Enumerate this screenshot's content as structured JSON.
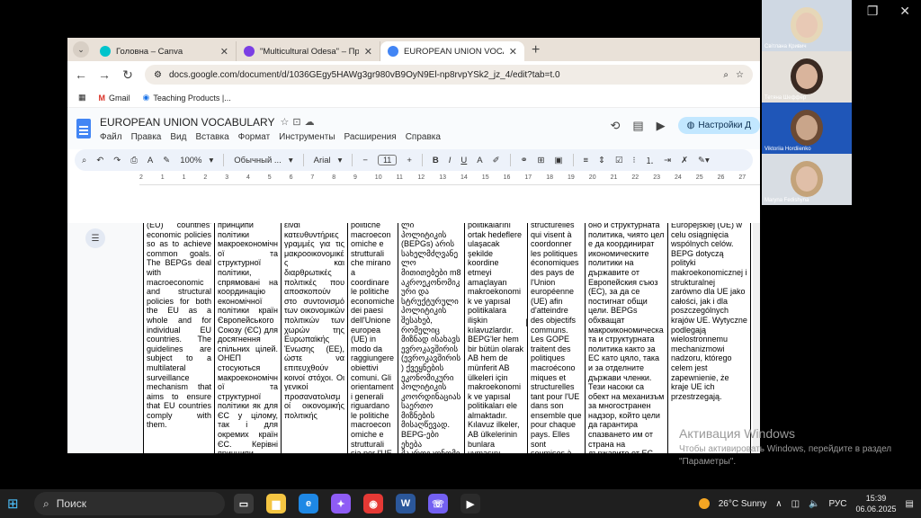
{
  "browser": {
    "tabs": [
      {
        "title": "Головна – Canva",
        "color": "#00c4cc",
        "active": false
      },
      {
        "title": "\"Multicultural Odesa\" – Презен",
        "color": "#7b3fe4",
        "active": false
      },
      {
        "title": "EUROPEAN UNION VOCABULA",
        "color": "#4285f4",
        "active": true
      }
    ],
    "url": "docs.google.com/document/d/1036GEgy5HAWg3gr980vB9OyN9El-np8rvpYSk2_jz_4/edit?tab=t.0",
    "bookmarks": [
      {
        "label": "Gmail"
      },
      {
        "label": "Teaching Products |..."
      }
    ]
  },
  "doc": {
    "title": "EUROPEAN UNION VOCABULARY",
    "menu": [
      "Файл",
      "Правка",
      "Вид",
      "Вставка",
      "Формат",
      "Инструменты",
      "Расширения",
      "Справка"
    ],
    "share_label": "Настройки Д",
    "toolbar": {
      "zoom": "100%",
      "style": "Обычный ...",
      "font": "Arial",
      "size": "11"
    },
    "ruler": [
      "2",
      "1",
      "1",
      "2",
      "3",
      "4",
      "5",
      "6",
      "7",
      "8",
      "9",
      "10",
      "11",
      "12",
      "13",
      "14",
      "15",
      "16",
      "17",
      "18",
      "19",
      "20",
      "21",
      "22",
      "23",
      "24",
      "25",
      "26",
      "27"
    ],
    "columns": [
      {
        "text": "(EU) countries' economic policies so as to achieve common goals. The BEPGs deal with macroeconomic and structural policies for both the EU as a whole and for individual EU countries. The guidelines are subject to a multilateral surveillance mechanism that aims to ensure that EU countries comply with them.",
        "width": 80,
        "justify": true
      },
      {
        "text": "принципи політики макроекономічної та структурної політики, спрямовані на координацію економічної політики країн Європейського Союзу (ЄС) для досягнення спільних цілей. ОНЕП стосуються макроекономічної та структурної політики як для ЄС у цілому, так і для окремих країн ЄС. Керівні принципи підлягають багатосторонньому",
        "width": 74,
        "justify": true
      },
      {
        "text": "είναι κατευθυντήριες γραμμές για τις μακροοικονομικές και διαρθρωτικές πολιτικές που αποσκοπούν στο συντονισμό των οικονομικών πολιτικών των χωρών της Ευρωπαϊκής Ένωσης (ΕΕ), ώστε να επιτευχθούν κοινοί στόχοι. Οι γενικοί προσανατολισμοί οικονομικής πολιτικής",
        "width": 74,
        "justify": true
      },
      {
        "text": "politiche macroeconomiche e strutturali che mirano a coordinare le politiche economiche dei paesi dell'Unione europea (UE) in modo da raggiungere obiettivi comuni. Gli orientamenti generali riguardano le politiche macroeconomiche e strutturali sia per l'UE nel suo complesso sia per i singoli paesi dell'UE. Gli orientamenti sono soggetti a",
        "width": 56,
        "justify": false
      },
      {
        "text": "ლი პოლიტიკის (BEPGs) არის სახელმძღვანელო მითითებები m8 აკროეკონომიკური და სტრუქტურული პოლიტიკის შესახებ, რომელიც მიზნად ისახავს ევროკავშირის (ევროკავშირის) ქვეყნების ეკონომიკური პოლიტიკის კოორდინაციას საერთო მიზნების მისაღწევად. BEPG-ები ეხება მაკროეკონომიკურ და სტრუქტურულ",
        "width": 74,
        "justify": false
      },
      {
        "text": "politikalarını ortak hedeflere ulaşacak şekilde koordine etmeyi amaçlayan makroekonomik ve yapısal politikalara ilişkin kılavuzlardır. BEPG'ler hem bir bütün olarak AB hem de münferit AB ülkeleri için makroekonomik ve yapısal politikaları ele almaktadır. Kılavuz ilkeler, AB ülkelerinin bunlara uymasını sağlamayı amaçlayan çok taraflı bir gözetim mekanizmasına",
        "width": 70,
        "justify": false
      },
      {
        "text": "structurelles qui visent à coordonner les politiques économiques des pays de l'Union européenne (UE) afin d'atteindre des objectifs communs. Les GOPE traitent des politiques macroéconomiques et structurelles tant pour l'UE dans son ensemble que pour chaque pays. Elles sont soumises à un mécanisme de surveillance",
        "width": 64,
        "justify": false
      },
      {
        "text": "оно и структурната политика, чиято цел е да координират икономическите политики на държавите от Европейския съюз (ЕС), за да се постигнат общи цели. BEPGs обхващат макроикономическата и структурната политика както за ЕС като цяло, така и за отделните държави членки. Тези насоки са обект на механизъм за многостранен надзор, който цели да гарантира спазването им от страна на държавите от ЕС.",
        "width": 92,
        "justify": false
      },
      {
        "text": "Europejskiej (UE) w celu osiągnięcia wspólnych celów. BEPG dotyczą polityki makroekonomicznej i strukturalnej zarówno dla UE jako całości, jak i dla poszczególnych krajów UE. Wytyczne podlegają wielostronnemu mechanizmowi nadzoru, którego celem jest zapewnienie, że kraje UE ich przestrzegają.",
        "width": 92,
        "justify": false
      }
    ]
  },
  "video": {
    "participants": [
      {
        "name": "Світлана Кривич",
        "bg": "#cfd8e3",
        "face": "#e8c9b5",
        "hair": "#e6d7b8"
      },
      {
        "name": "Тетяна Шеффер",
        "bg": "#e4e0da",
        "face": "#d9b49c",
        "hair": "#3a2a22"
      },
      {
        "name": "Viktoriia Hordiienko",
        "bg": "#1f56b8",
        "face": "#c9a58a",
        "hair": "#6b4a34"
      },
      {
        "name": "Maryna Fedishyna",
        "bg": "#d8dde3",
        "face": "#e0bfa8",
        "hair": "#c4a37a"
      }
    ]
  },
  "watermark": {
    "title": "Активация Windows",
    "text": "Чтобы активировать Windows, перейдите в раздел \"Параметры\"."
  },
  "taskbar": {
    "search_placeholder": "Поиск",
    "apps": [
      {
        "name": "task-view",
        "color": "#3a3a3a",
        "glyph": "▭"
      },
      {
        "name": "file-explorer",
        "color": "#f4c542",
        "glyph": "▆"
      },
      {
        "name": "edge",
        "color": "#1e88e5",
        "glyph": "e"
      },
      {
        "name": "copilot",
        "color": "#8e5cf5",
        "glyph": "✦"
      },
      {
        "name": "chrome",
        "color": "#e53935",
        "glyph": "◉"
      },
      {
        "name": "word",
        "color": "#2b579a",
        "glyph": "W"
      },
      {
        "name": "viber",
        "color": "#7360f2",
        "glyph": "☏"
      },
      {
        "name": "media",
        "color": "#2b2b2b",
        "glyph": "▶"
      }
    ],
    "weather": "26°C Sunny",
    "lang": "РУС",
    "time": "15:39",
    "date": "06.06.2025"
  }
}
